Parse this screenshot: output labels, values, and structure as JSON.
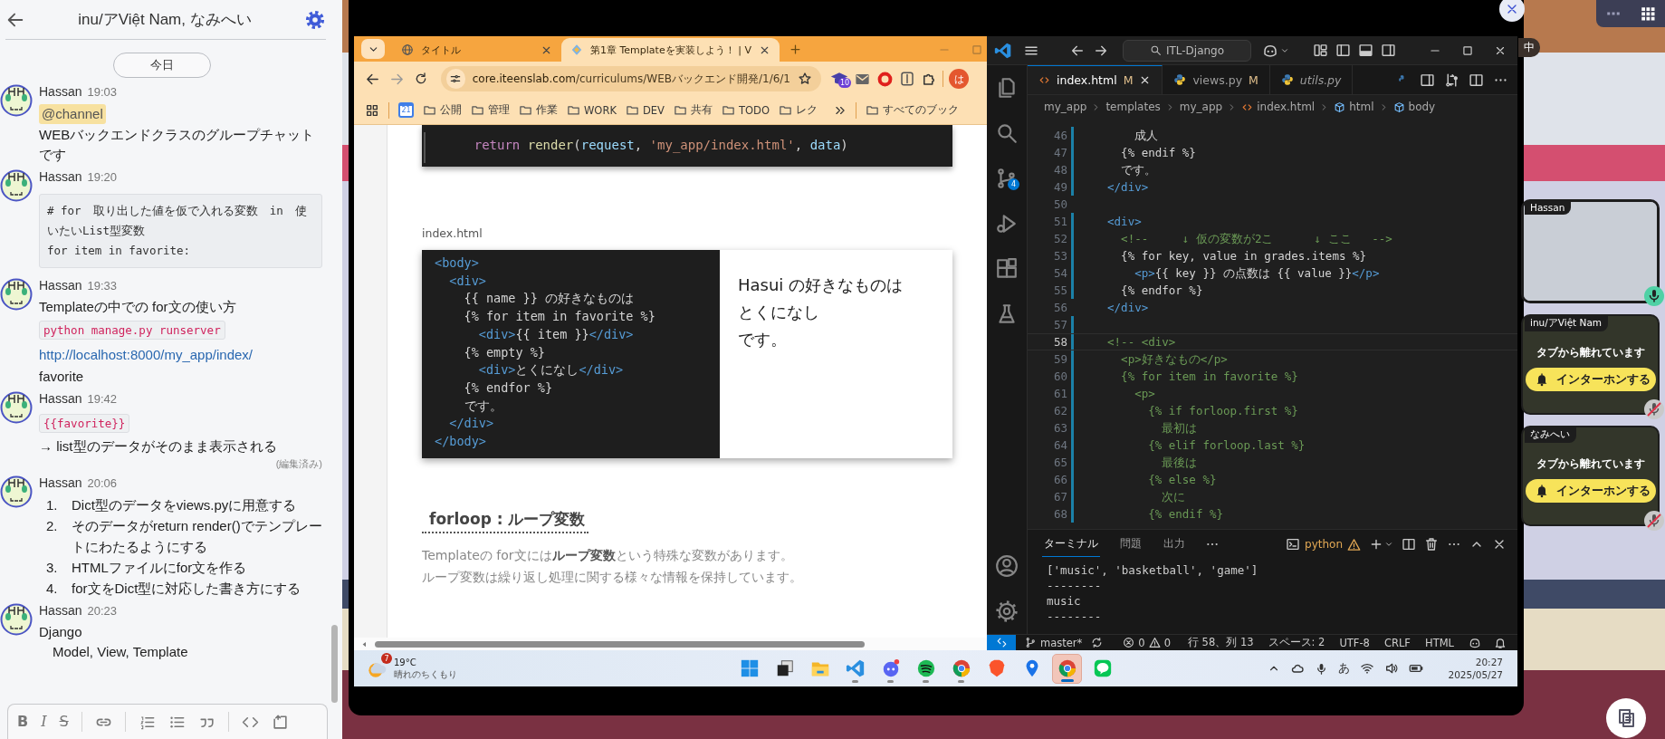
{
  "chat": {
    "title": "inu/アViệt Nam, なみへい",
    "date_divider": "今日",
    "messages": [
      {
        "author": "Hassan",
        "time": "19:03",
        "blocks": [
          {
            "kind": "mention",
            "text": "@channel"
          },
          {
            "kind": "text",
            "text": "WEBバックエンドクラスのグループチャットです"
          }
        ]
      },
      {
        "author": "Hassan",
        "time": "19:20",
        "blocks": [
          {
            "kind": "code_block",
            "lines": [
              "# for　取り出した値を仮で入れる変数　in　使いたいList型変数",
              "for item in favorite:"
            ]
          }
        ]
      },
      {
        "author": "Hassan",
        "time": "19:33",
        "blocks": [
          {
            "kind": "text",
            "text": "Templateの中での for文の使い方"
          },
          {
            "kind": "inline_code",
            "text": "python manage.py runserver"
          },
          {
            "kind": "link",
            "text": "http://localhost:8000/my_app/index/"
          },
          {
            "kind": "text",
            "text": "favorite"
          }
        ]
      },
      {
        "author": "Hassan",
        "time": "19:42",
        "blocks": [
          {
            "kind": "inline_code",
            "text": "{{favorite}}"
          },
          {
            "kind": "text",
            "text": "→ list型のデータがそのまま表示される"
          },
          {
            "kind": "edited",
            "text": "(編集済み)"
          }
        ]
      },
      {
        "author": "Hassan",
        "time": "20:06",
        "blocks": [
          {
            "kind": "numbered_list",
            "items": [
              {
                "number": "1.",
                "text": "Dict型のデータをviews.pyに用意する"
              },
              {
                "number": "2.",
                "text": "そのデータがreturn render()でテンプレートにわたるようにする"
              },
              {
                "number": "3.",
                "text": "HTMLファイルにfor文を作る"
              },
              {
                "number": "4.",
                "text": "for文をDict型に対応した書き方にする"
              }
            ]
          }
        ]
      },
      {
        "author": "Hassan",
        "time": "20:23",
        "blocks": [
          {
            "kind": "text",
            "text": "Django"
          },
          {
            "kind": "indented",
            "text": "Model, View, Template"
          }
        ]
      }
    ],
    "composer_toolbar": [
      {
        "kind": "bold",
        "glyph": "B"
      },
      {
        "kind": "italic",
        "glyph": "I"
      },
      {
        "kind": "strike",
        "glyph": "S"
      },
      {
        "kind": "link"
      },
      {
        "kind": "ordered_list"
      },
      {
        "kind": "bullet_list"
      },
      {
        "kind": "quote"
      },
      {
        "kind": "code"
      },
      {
        "kind": "attach"
      }
    ]
  },
  "browser": {
    "tabs": [
      {
        "kind": "globe",
        "title": "タイトル",
        "selected": false
      },
      {
        "kind": "site",
        "title": "第1章 Templateを実装しよう！ | V",
        "selected": true
      }
    ],
    "address": {
      "domain": "core.iteenslab.com",
      "path": "/curriculums/WEBバックエンド開発/1/6/1"
    },
    "extension_badge": "10",
    "profile_initial": "は",
    "bookmarks": [
      {
        "kind": "apps"
      },
      {
        "kind": "calendar",
        "label": "21"
      },
      {
        "kind": "folder",
        "label": "公開"
      },
      {
        "kind": "folder",
        "label": "管理"
      },
      {
        "kind": "folder",
        "label": "作業"
      },
      {
        "kind": "folder",
        "label": "WORK"
      },
      {
        "kind": "folder",
        "label": "DEV"
      },
      {
        "kind": "folder",
        "label": "共有"
      },
      {
        "kind": "folder",
        "label": "TODO"
      },
      {
        "kind": "folder",
        "label": "レク"
      },
      {
        "kind": "more"
      },
      {
        "kind": "folder",
        "label": "すべてのブック"
      }
    ],
    "page": {
      "top_code": [
        {
          "kind": "keyword",
          "text": "    return "
        },
        {
          "kind": "function",
          "text": "render"
        },
        {
          "kind": "punct",
          "text": "("
        },
        {
          "kind": "variable",
          "text": "request"
        },
        {
          "kind": "punct",
          "text": ", "
        },
        {
          "kind": "string",
          "text": "'my_app/index.html'"
        },
        {
          "kind": "punct",
          "text": ", "
        },
        {
          "kind": "variable",
          "text": "data"
        },
        {
          "kind": "punct",
          "text": ")"
        }
      ],
      "caption": "index.html",
      "example_code": [
        [
          {
            "kind": "tag",
            "text": "<body>"
          }
        ],
        [
          {
            "kind": "tag",
            "text": "  <div>"
          }
        ],
        [
          {
            "kind": "text",
            "text": "    {{ name }} の好きなものは"
          }
        ],
        [
          {
            "kind": "text",
            "text": "    {% for item in favorite %}"
          }
        ],
        [
          {
            "kind": "tag",
            "text": "      <div>"
          },
          {
            "kind": "text",
            "text": "{{ item }}"
          },
          {
            "kind": "tag",
            "text": "</div>"
          }
        ],
        [
          {
            "kind": "text",
            "text": "    {% empty %}"
          }
        ],
        [
          {
            "kind": "tag",
            "text": "      <div>"
          },
          {
            "kind": "text",
            "text": "とくになし"
          },
          {
            "kind": "tag",
            "text": "</div>"
          }
        ],
        [
          {
            "kind": "text",
            "text": "    {% endfor %}"
          }
        ],
        [
          {
            "kind": "text",
            "text": "    です。"
          }
        ],
        [
          {
            "kind": "tag",
            "text": "  </div>"
          }
        ],
        [
          {
            "kind": "tag",
            "text": "</body>"
          }
        ]
      ],
      "example_output": [
        "Hasui の好きなものは",
        "とくになし",
        "です。"
      ],
      "heading": "forloop : ループ変数",
      "paragraph": [
        "Templateの for文には**ループ変数**という特殊な変数があります。",
        "ループ変数は繰り返し処理に関する様々な情報を保持しています。"
      ]
    }
  },
  "vscode": {
    "search": "ITL-Django",
    "scm_badge": "4",
    "tabs": [
      {
        "kind": "html",
        "name": "index.html",
        "status": "M",
        "selected": true,
        "preview": false
      },
      {
        "kind": "python",
        "name": "views.py",
        "status": "M",
        "selected": false,
        "preview": false
      },
      {
        "kind": "python",
        "name": "utils.py",
        "selected": false,
        "preview": true
      }
    ],
    "breadcrumb": [
      {
        "kind": "folder",
        "label": "my_app"
      },
      {
        "kind": "folder",
        "label": "templates"
      },
      {
        "kind": "folder",
        "label": "my_app"
      },
      {
        "kind": "file",
        "label": "index.html"
      },
      {
        "kind": "element",
        "label": "html"
      },
      {
        "kind": "element",
        "label": "body"
      }
    ],
    "lines": [
      {
        "number": "46",
        "current": false,
        "modified": true,
        "segments": [
          {
            "kind": "text",
            "text": "      成人"
          }
        ]
      },
      {
        "number": "47",
        "current": false,
        "modified": true,
        "segments": [
          {
            "kind": "text",
            "text": "    {% endif %}"
          }
        ]
      },
      {
        "number": "48",
        "current": false,
        "modified": true,
        "segments": [
          {
            "kind": "text",
            "text": "    です。"
          }
        ]
      },
      {
        "number": "49",
        "current": false,
        "modified": true,
        "segments": [
          {
            "kind": "tag",
            "text": "  </div>"
          }
        ]
      },
      {
        "number": "50",
        "current": false,
        "modified": false
      },
      {
        "number": "51",
        "current": false,
        "modified": true,
        "segments": [
          {
            "kind": "tag",
            "text": "  <div>"
          }
        ]
      },
      {
        "number": "52",
        "current": false,
        "modified": true,
        "segments": [
          {
            "kind": "comment",
            "text": "    <!--     ↓ 仮の変数が2こ      ↓ ここ   -->"
          }
        ]
      },
      {
        "number": "53",
        "current": false,
        "modified": true,
        "segments": [
          {
            "kind": "text",
            "text": "    {% for key, value in grades.items %}"
          }
        ]
      },
      {
        "number": "54",
        "current": false,
        "modified": true,
        "segments": [
          {
            "kind": "tag",
            "text": "      <p>"
          },
          {
            "kind": "text",
            "text": "{{ key }} の点数は {{ value }}"
          },
          {
            "kind": "tag",
            "text": "</p>"
          }
        ]
      },
      {
        "number": "55",
        "current": false,
        "modified": true,
        "segments": [
          {
            "kind": "text",
            "text": "    {% endfor %}"
          }
        ]
      },
      {
        "number": "56",
        "current": false,
        "modified": false,
        "segments": [
          {
            "kind": "tag",
            "text": "  </div>"
          }
        ]
      },
      {
        "number": "57",
        "current": false,
        "modified": true
      },
      {
        "number": "58",
        "current": true,
        "modified": true,
        "segments": [
          {
            "kind": "comment",
            "text": "  <!-- <div>"
          }
        ]
      },
      {
        "number": "59",
        "current": false,
        "modified": true,
        "segments": [
          {
            "kind": "comment",
            "text": "    <p>好きなもの</p>"
          }
        ]
      },
      {
        "number": "60",
        "current": false,
        "modified": true,
        "segments": [
          {
            "kind": "comment",
            "text": "    {% for item in favorite %}"
          }
        ]
      },
      {
        "number": "61",
        "current": false,
        "modified": true,
        "segments": [
          {
            "kind": "comment",
            "text": "      <p>"
          }
        ]
      },
      {
        "number": "62",
        "current": false,
        "modified": true,
        "segments": [
          {
            "kind": "comment",
            "text": "        {% if forloop.first %}"
          }
        ]
      },
      {
        "number": "63",
        "current": false,
        "modified": true,
        "segments": [
          {
            "kind": "comment",
            "text": "          最初は"
          }
        ]
      },
      {
        "number": "64",
        "current": false,
        "modified": true,
        "segments": [
          {
            "kind": "comment",
            "text": "        {% elif forloop.last %}"
          }
        ]
      },
      {
        "number": "65",
        "current": false,
        "modified": true,
        "segments": [
          {
            "kind": "comment",
            "text": "          最後は"
          }
        ]
      },
      {
        "number": "66",
        "current": false,
        "modified": true,
        "segments": [
          {
            "kind": "comment",
            "text": "        {% else %}"
          }
        ]
      },
      {
        "number": "67",
        "current": false,
        "modified": true,
        "segments": [
          {
            "kind": "comment",
            "text": "          次に"
          }
        ]
      },
      {
        "number": "68",
        "current": false,
        "modified": true,
        "segments": [
          {
            "kind": "comment",
            "text": "        {% endif %}"
          }
        ]
      }
    ],
    "panel": {
      "tabs": [
        {
          "label": "ターミナル",
          "selected": true
        },
        {
          "label": "問題",
          "selected": false
        },
        {
          "label": "出力",
          "selected": false
        }
      ],
      "shell": "python",
      "output": [
        "['music', 'basketball', 'game']",
        "--------",
        "music",
        "--------"
      ]
    },
    "status": {
      "branch": "master*",
      "errors": "0",
      "warnings": "0",
      "position": "行 58、列 13",
      "indent": "スペース: 2",
      "encoding": "UTF-8",
      "eol": "CRLF",
      "language": "HTML"
    }
  },
  "taskbar": {
    "weather": {
      "badge": "7",
      "temp": "19°C",
      "condition": "晴れのちくもり"
    },
    "apps": [
      {
        "kind": "start",
        "running": false,
        "active": false
      },
      {
        "kind": "taskview",
        "running": false,
        "active": false
      },
      {
        "kind": "explorer",
        "running": false,
        "active": false
      },
      {
        "kind": "vscode",
        "running": true,
        "active": false
      },
      {
        "kind": "discord",
        "running": true,
        "active": false
      },
      {
        "kind": "spotify",
        "running": true,
        "active": false
      },
      {
        "kind": "chrome",
        "running": true,
        "active": false
      },
      {
        "kind": "brave",
        "running": false,
        "active": false
      },
      {
        "kind": "maps",
        "running": false,
        "active": false
      },
      {
        "kind": "chrome",
        "running": true,
        "active": true
      },
      {
        "kind": "line",
        "running": false,
        "active": false
      }
    ],
    "ime": "あ",
    "time": "20:27",
    "date": "2025/05/27"
  },
  "stage": {
    "map_label": "中",
    "view_modes": [
      {
        "kind": "row",
        "selected": false
      },
      {
        "kind": "grid",
        "selected": true
      }
    ],
    "video_tiles": [
      {
        "kind": "video",
        "name": "Hassan",
        "muted": false
      },
      {
        "kind": "away",
        "name": "inu/アViệt Nam",
        "status": "タブから離れています",
        "button": "インターホンする",
        "muted": true
      },
      {
        "kind": "away",
        "name": "なみへい",
        "status": "タブから離れています",
        "button": "インターホンする",
        "muted": true
      }
    ]
  }
}
